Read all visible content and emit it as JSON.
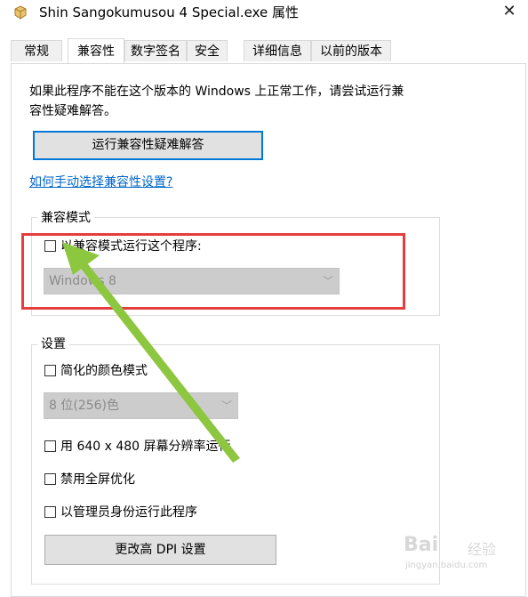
{
  "window": {
    "title": "Shin Sangokumusou 4 Special.exe 属性",
    "close_label": "✕"
  },
  "tabs": [
    {
      "label": "常规"
    },
    {
      "label": "兼容性"
    },
    {
      "label": "数字签名"
    },
    {
      "label": "安全"
    },
    {
      "label": "详细信息"
    },
    {
      "label": "以前的版本"
    }
  ],
  "active_tab": "兼容性",
  "compat": {
    "intro_line1": "如果此程序不能在这个版本的 Windows 上正常工作，请尝试运行兼",
    "intro_line2": "容性疑难解答。",
    "troubleshooter_button": "运行兼容性疑难解答",
    "manual_link": "如何手动选择兼容性设置?",
    "mode_group_label": "兼容模式",
    "mode_checkbox_label": "以兼容模式运行这个程序:",
    "mode_checkbox_checked": false,
    "mode_select_value": "Windows 8"
  },
  "settings": {
    "group_label": "设置",
    "reduced_color_label": "简化的颜色模式",
    "reduced_color_checked": false,
    "color_select_value": "8 位(256)色",
    "run_640_label": "用 640 x 480 屏幕分辨率运行",
    "run_640_checked": false,
    "disable_fullscreen_label": "禁用全屏优化",
    "disable_fullscreen_checked": false,
    "run_as_admin_label": "以管理员身份运行此程序",
    "run_as_admin_checked": false,
    "dpi_button": "更改高 DPI 设置"
  },
  "watermark": {
    "brand": "Bai",
    "brand2": "经验",
    "url": "jingyan.baidu.com"
  },
  "colors": {
    "accent": "#0078d7",
    "annotation_box": "#e43d3d",
    "annotation_arrow": "#8dc63f",
    "link": "#0066cc"
  }
}
